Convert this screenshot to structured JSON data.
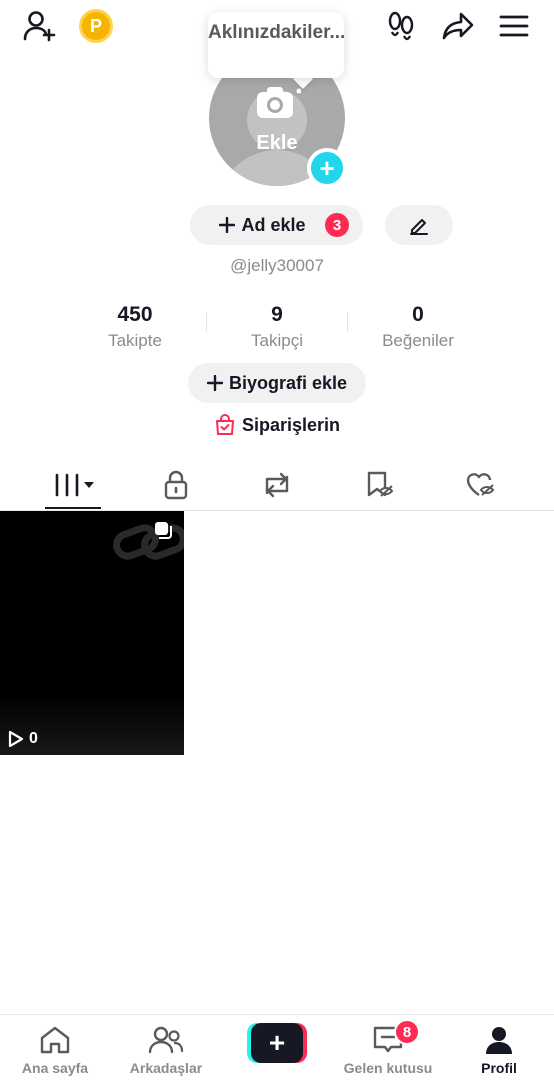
{
  "header": {
    "coin_letter": "P",
    "tooltip": "Aklınızdakiler..."
  },
  "profile": {
    "avatar_label": "Ekle",
    "add_name_label": "Ad ekle",
    "add_name_badge": "3",
    "username": "@jelly30007",
    "stats": [
      {
        "value": "450",
        "label": "Takipte"
      },
      {
        "value": "9",
        "label": "Takipçi"
      },
      {
        "value": "0",
        "label": "Beğeniler"
      }
    ],
    "bio_label": "Biyografi ekle",
    "orders_label": "Siparişlerin"
  },
  "tabs": [
    "videos-grid-icon",
    "lock-icon",
    "repost-icon",
    "saved-icon",
    "liked-icon"
  ],
  "videos": [
    {
      "views": "0"
    }
  ],
  "bottom_nav": [
    {
      "label": "Ana sayfa",
      "icon": "home-icon"
    },
    {
      "label": "Arkadaşlar",
      "icon": "friends-icon"
    },
    {
      "label": "",
      "icon": "create-icon"
    },
    {
      "label": "Gelen kutusu",
      "icon": "inbox-icon",
      "badge": "8"
    },
    {
      "label": "Profil",
      "icon": "profile-icon",
      "active": true
    }
  ],
  "colors": {
    "accent_red": "#fe2c55",
    "accent_cyan": "#25f4ee",
    "coin": "#f5b400",
    "text_secondary": "#8a8b91"
  }
}
